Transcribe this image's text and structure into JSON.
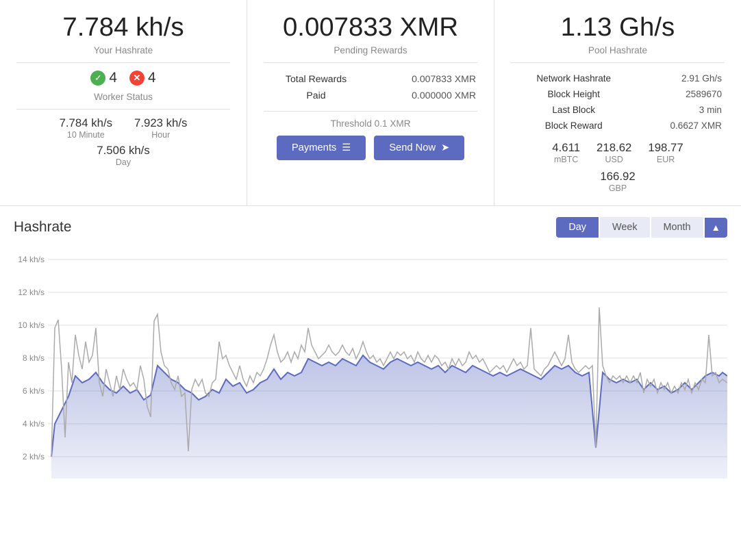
{
  "cards": {
    "hashrate": {
      "main_value": "7.784 kh/s",
      "subtitle": "Your Hashrate",
      "workers_online": "4",
      "workers_offline": "4",
      "worker_status_label": "Worker Status",
      "rate_10min": "7.784 kh/s",
      "rate_10min_label": "10 Minute",
      "rate_hour": "7.923 kh/s",
      "rate_hour_label": "Hour",
      "rate_day": "7.506 kh/s",
      "rate_day_label": "Day"
    },
    "rewards": {
      "main_value": "0.007833 XMR",
      "subtitle": "Pending Rewards",
      "total_rewards_label": "Total Rewards",
      "total_rewards_value": "0.007833 XMR",
      "paid_label": "Paid",
      "paid_value": "0.000000 XMR",
      "threshold_text": "Threshold 0.1 XMR",
      "btn_payments": "Payments",
      "btn_send_now": "Send Now"
    },
    "pool": {
      "main_value": "1.13 Gh/s",
      "subtitle": "Pool Hashrate",
      "network_hashrate_label": "Network Hashrate",
      "network_hashrate_value": "2.91 Gh/s",
      "block_height_label": "Block Height",
      "block_height_value": "2589670",
      "last_block_label": "Last Block",
      "last_block_value": "3 min",
      "block_reward_label": "Block Reward",
      "block_reward_value": "0.6627 XMR",
      "price_mbtc": "4.611",
      "price_mbtc_label": "mBTC",
      "price_usd": "218.62",
      "price_usd_label": "USD",
      "price_eur": "198.77",
      "price_eur_label": "EUR",
      "price_gbp": "166.92",
      "price_gbp_label": "GBP"
    }
  },
  "chart": {
    "title": "Hashrate",
    "tabs": [
      "Day",
      "Week",
      "Month"
    ],
    "active_tab": "Day",
    "y_labels": [
      "14 kh/s",
      "12 kh/s",
      "10 kh/s",
      "8 kh/s",
      "6 kh/s",
      "4 kh/s",
      "2 kh/s"
    ],
    "colors": {
      "fill": "rgba(92, 107, 192, 0.25)",
      "line_blue": "#5c6bc0",
      "line_gray": "#aaa"
    }
  }
}
